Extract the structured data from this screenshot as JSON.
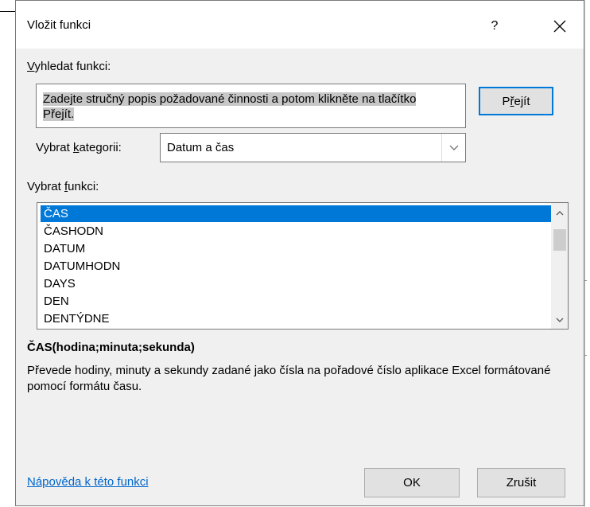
{
  "dialog": {
    "title": "Vložit funkci",
    "help_glyph": "?",
    "close_glyph": "✕"
  },
  "search": {
    "label_hotkey": "V",
    "label_rest": "yhledat funkci:",
    "placeholder": "Zadejte stručný popis požadované činnosti a potom klikněte na tlačítko Přejít.",
    "go_button": {
      "before": "P",
      "hotkey": "ř",
      "after": "ejít"
    }
  },
  "category": {
    "label_before": "Vybrat ",
    "label_hotkey": "k",
    "label_after": "ategorii:",
    "selected": "Datum a čas"
  },
  "function_list": {
    "label_before": "Vybrat ",
    "label_hotkey": "f",
    "label_after": "unkci:",
    "items": [
      "ČAS",
      "ČASHODN",
      "DATUM",
      "DATUMHODN",
      "DAYS",
      "DEN",
      "DENTÝDNE"
    ],
    "selected_index": 0
  },
  "details": {
    "signature": "ČAS(hodina;minuta;sekunda)",
    "description": "Převede hodiny, minuty a sekundy zadané jako čísla na pořadové číslo aplikace Excel formátované pomocí formátu času."
  },
  "footer": {
    "help_link": "Nápověda k této funkci",
    "ok": "OK",
    "cancel": "Zrušit"
  }
}
